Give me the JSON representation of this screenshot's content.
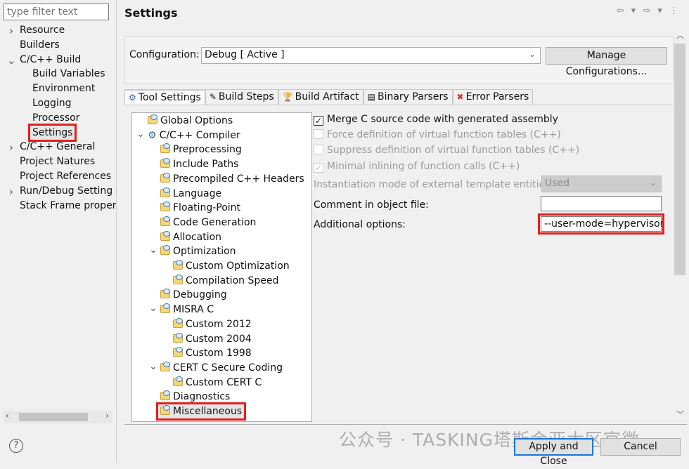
{
  "filter": {
    "placeholder": "type filter text"
  },
  "left_tree": [
    {
      "label": "Resource",
      "level": 0,
      "chev": "right"
    },
    {
      "label": "Builders",
      "level": 0
    },
    {
      "label": "C/C++ Build",
      "level": 0,
      "chev": "down"
    },
    {
      "label": "Build Variables",
      "level": 1
    },
    {
      "label": "Environment",
      "level": 1
    },
    {
      "label": "Logging",
      "level": 1
    },
    {
      "label": "Processor",
      "level": 1
    },
    {
      "label": "Settings",
      "level": 1,
      "selected": true
    },
    {
      "label": "C/C++ General",
      "level": 0,
      "chev": "right"
    },
    {
      "label": "Project Natures",
      "level": 0
    },
    {
      "label": "Project References",
      "level": 0
    },
    {
      "label": "Run/Debug Setting",
      "level": 0,
      "chev": "right"
    },
    {
      "label": "Stack Frame proper",
      "level": 0
    }
  ],
  "header": {
    "title": "Settings",
    "nav": "⇦ ▾ ⇨ ▾ ⋮"
  },
  "config": {
    "label": "Configuration:",
    "value": "Debug  [ Active ]",
    "manage_label": "Manage Configurations..."
  },
  "tabs": [
    {
      "label": "Tool Settings",
      "icon": "gear-icon",
      "glyph": "⚙",
      "active": true
    },
    {
      "label": "Build Steps",
      "icon": "brush-icon",
      "glyph": "✎"
    },
    {
      "label": "Build Artifact",
      "icon": "trophy-icon",
      "glyph": "🏆"
    },
    {
      "label": "Binary Parsers",
      "icon": "binary-icon",
      "glyph": "▤"
    },
    {
      "label": "Error Parsers",
      "icon": "error-icon",
      "glyph": "✖"
    }
  ],
  "tool_tree": [
    {
      "label": "Global Options",
      "level": 0
    },
    {
      "label": "C/C++ Compiler",
      "level": 0,
      "chev": "down",
      "gear": true
    },
    {
      "label": "Preprocessing",
      "level": 1
    },
    {
      "label": "Include Paths",
      "level": 1
    },
    {
      "label": "Precompiled C++ Headers",
      "level": 1
    },
    {
      "label": "Language",
      "level": 1
    },
    {
      "label": "Floating-Point",
      "level": 1
    },
    {
      "label": "Code Generation",
      "level": 1
    },
    {
      "label": "Allocation",
      "level": 1
    },
    {
      "label": "Optimization",
      "level": 1,
      "chev": "down"
    },
    {
      "label": "Custom Optimization",
      "level": 2
    },
    {
      "label": "Compilation Speed",
      "level": 2
    },
    {
      "label": "Debugging",
      "level": 1
    },
    {
      "label": "MISRA C",
      "level": 1,
      "chev": "down"
    },
    {
      "label": "Custom 2012",
      "level": 2
    },
    {
      "label": "Custom 2004",
      "level": 2
    },
    {
      "label": "Custom 1998",
      "level": 2
    },
    {
      "label": "CERT C Secure Coding",
      "level": 1,
      "chev": "down"
    },
    {
      "label": "Custom CERT C",
      "level": 2
    },
    {
      "label": "Diagnostics",
      "level": 1
    },
    {
      "label": "Miscellaneous",
      "level": 1,
      "selected": true
    }
  ],
  "options": {
    "merge": {
      "label": "Merge C source code with generated assembly",
      "checked": true
    },
    "force": {
      "label": "Force definition of virtual function tables (C++)",
      "checked": false
    },
    "suppress": {
      "label": "Suppress definition of virtual function tables (C++)",
      "checked": false
    },
    "minimal": {
      "label": "Minimal inlining of function calls (C++)",
      "checked": true
    },
    "instantiation": {
      "label": "Instantiation mode of external template entities:",
      "value": "Used"
    },
    "comment": {
      "label": "Comment in object file:",
      "value": ""
    },
    "additional": {
      "label": "Additional options:",
      "value": "--user-mode=hypervisor"
    }
  },
  "footer": {
    "help": "?",
    "apply_label": "Apply and Close",
    "cancel_label": "Cancel",
    "watermark": "公众号 · TASKING塔斯金亚太区官微"
  },
  "colors": {
    "highlight": "#e02020",
    "focus": "#1a74d2"
  }
}
